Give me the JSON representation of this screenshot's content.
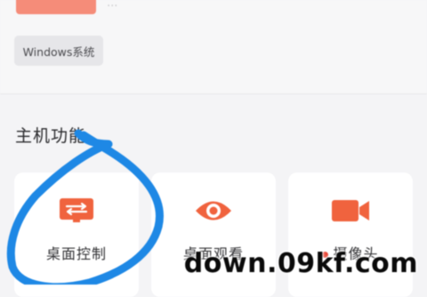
{
  "top": {
    "os_tag": "Windows系统",
    "faded_text": "...",
    "accent": "#f58c79"
  },
  "section": {
    "title": "主机功能"
  },
  "features": [
    {
      "label": "桌面控制",
      "icon": "remote-desktop-icon"
    },
    {
      "label": "桌面观看",
      "icon": "eye-icon"
    },
    {
      "label": "摄像头",
      "icon": "video-camera-icon"
    }
  ],
  "colors": {
    "icon_orange": "#f0633e",
    "scribble_blue": "#1e88e5",
    "status_dot": "#e84a3a"
  },
  "watermark": "down.09kf.com"
}
